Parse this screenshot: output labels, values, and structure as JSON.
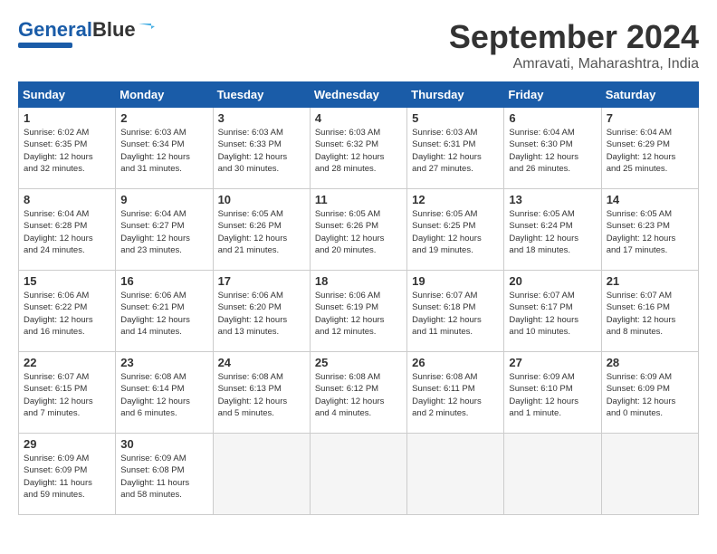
{
  "logo": {
    "text1": "General",
    "text2": "Blue"
  },
  "title": "September 2024",
  "subtitle": "Amravati, Maharashtra, India",
  "days_header": [
    "Sunday",
    "Monday",
    "Tuesday",
    "Wednesday",
    "Thursday",
    "Friday",
    "Saturday"
  ],
  "weeks": [
    [
      {
        "day": "1",
        "info": "Sunrise: 6:02 AM\nSunset: 6:35 PM\nDaylight: 12 hours\nand 32 minutes."
      },
      {
        "day": "2",
        "info": "Sunrise: 6:03 AM\nSunset: 6:34 PM\nDaylight: 12 hours\nand 31 minutes."
      },
      {
        "day": "3",
        "info": "Sunrise: 6:03 AM\nSunset: 6:33 PM\nDaylight: 12 hours\nand 30 minutes."
      },
      {
        "day": "4",
        "info": "Sunrise: 6:03 AM\nSunset: 6:32 PM\nDaylight: 12 hours\nand 28 minutes."
      },
      {
        "day": "5",
        "info": "Sunrise: 6:03 AM\nSunset: 6:31 PM\nDaylight: 12 hours\nand 27 minutes."
      },
      {
        "day": "6",
        "info": "Sunrise: 6:04 AM\nSunset: 6:30 PM\nDaylight: 12 hours\nand 26 minutes."
      },
      {
        "day": "7",
        "info": "Sunrise: 6:04 AM\nSunset: 6:29 PM\nDaylight: 12 hours\nand 25 minutes."
      }
    ],
    [
      {
        "day": "8",
        "info": "Sunrise: 6:04 AM\nSunset: 6:28 PM\nDaylight: 12 hours\nand 24 minutes."
      },
      {
        "day": "9",
        "info": "Sunrise: 6:04 AM\nSunset: 6:27 PM\nDaylight: 12 hours\nand 23 minutes."
      },
      {
        "day": "10",
        "info": "Sunrise: 6:05 AM\nSunset: 6:26 PM\nDaylight: 12 hours\nand 21 minutes."
      },
      {
        "day": "11",
        "info": "Sunrise: 6:05 AM\nSunset: 6:26 PM\nDaylight: 12 hours\nand 20 minutes."
      },
      {
        "day": "12",
        "info": "Sunrise: 6:05 AM\nSunset: 6:25 PM\nDaylight: 12 hours\nand 19 minutes."
      },
      {
        "day": "13",
        "info": "Sunrise: 6:05 AM\nSunset: 6:24 PM\nDaylight: 12 hours\nand 18 minutes."
      },
      {
        "day": "14",
        "info": "Sunrise: 6:05 AM\nSunset: 6:23 PM\nDaylight: 12 hours\nand 17 minutes."
      }
    ],
    [
      {
        "day": "15",
        "info": "Sunrise: 6:06 AM\nSunset: 6:22 PM\nDaylight: 12 hours\nand 16 minutes."
      },
      {
        "day": "16",
        "info": "Sunrise: 6:06 AM\nSunset: 6:21 PM\nDaylight: 12 hours\nand 14 minutes."
      },
      {
        "day": "17",
        "info": "Sunrise: 6:06 AM\nSunset: 6:20 PM\nDaylight: 12 hours\nand 13 minutes."
      },
      {
        "day": "18",
        "info": "Sunrise: 6:06 AM\nSunset: 6:19 PM\nDaylight: 12 hours\nand 12 minutes."
      },
      {
        "day": "19",
        "info": "Sunrise: 6:07 AM\nSunset: 6:18 PM\nDaylight: 12 hours\nand 11 minutes."
      },
      {
        "day": "20",
        "info": "Sunrise: 6:07 AM\nSunset: 6:17 PM\nDaylight: 12 hours\nand 10 minutes."
      },
      {
        "day": "21",
        "info": "Sunrise: 6:07 AM\nSunset: 6:16 PM\nDaylight: 12 hours\nand 8 minutes."
      }
    ],
    [
      {
        "day": "22",
        "info": "Sunrise: 6:07 AM\nSunset: 6:15 PM\nDaylight: 12 hours\nand 7 minutes."
      },
      {
        "day": "23",
        "info": "Sunrise: 6:08 AM\nSunset: 6:14 PM\nDaylight: 12 hours\nand 6 minutes."
      },
      {
        "day": "24",
        "info": "Sunrise: 6:08 AM\nSunset: 6:13 PM\nDaylight: 12 hours\nand 5 minutes."
      },
      {
        "day": "25",
        "info": "Sunrise: 6:08 AM\nSunset: 6:12 PM\nDaylight: 12 hours\nand 4 minutes."
      },
      {
        "day": "26",
        "info": "Sunrise: 6:08 AM\nSunset: 6:11 PM\nDaylight: 12 hours\nand 2 minutes."
      },
      {
        "day": "27",
        "info": "Sunrise: 6:09 AM\nSunset: 6:10 PM\nDaylight: 12 hours\nand 1 minute."
      },
      {
        "day": "28",
        "info": "Sunrise: 6:09 AM\nSunset: 6:09 PM\nDaylight: 12 hours\nand 0 minutes."
      }
    ],
    [
      {
        "day": "29",
        "info": "Sunrise: 6:09 AM\nSunset: 6:09 PM\nDaylight: 11 hours\nand 59 minutes."
      },
      {
        "day": "30",
        "info": "Sunrise: 6:09 AM\nSunset: 6:08 PM\nDaylight: 11 hours\nand 58 minutes."
      },
      {
        "day": "",
        "info": ""
      },
      {
        "day": "",
        "info": ""
      },
      {
        "day": "",
        "info": ""
      },
      {
        "day": "",
        "info": ""
      },
      {
        "day": "",
        "info": ""
      }
    ]
  ]
}
